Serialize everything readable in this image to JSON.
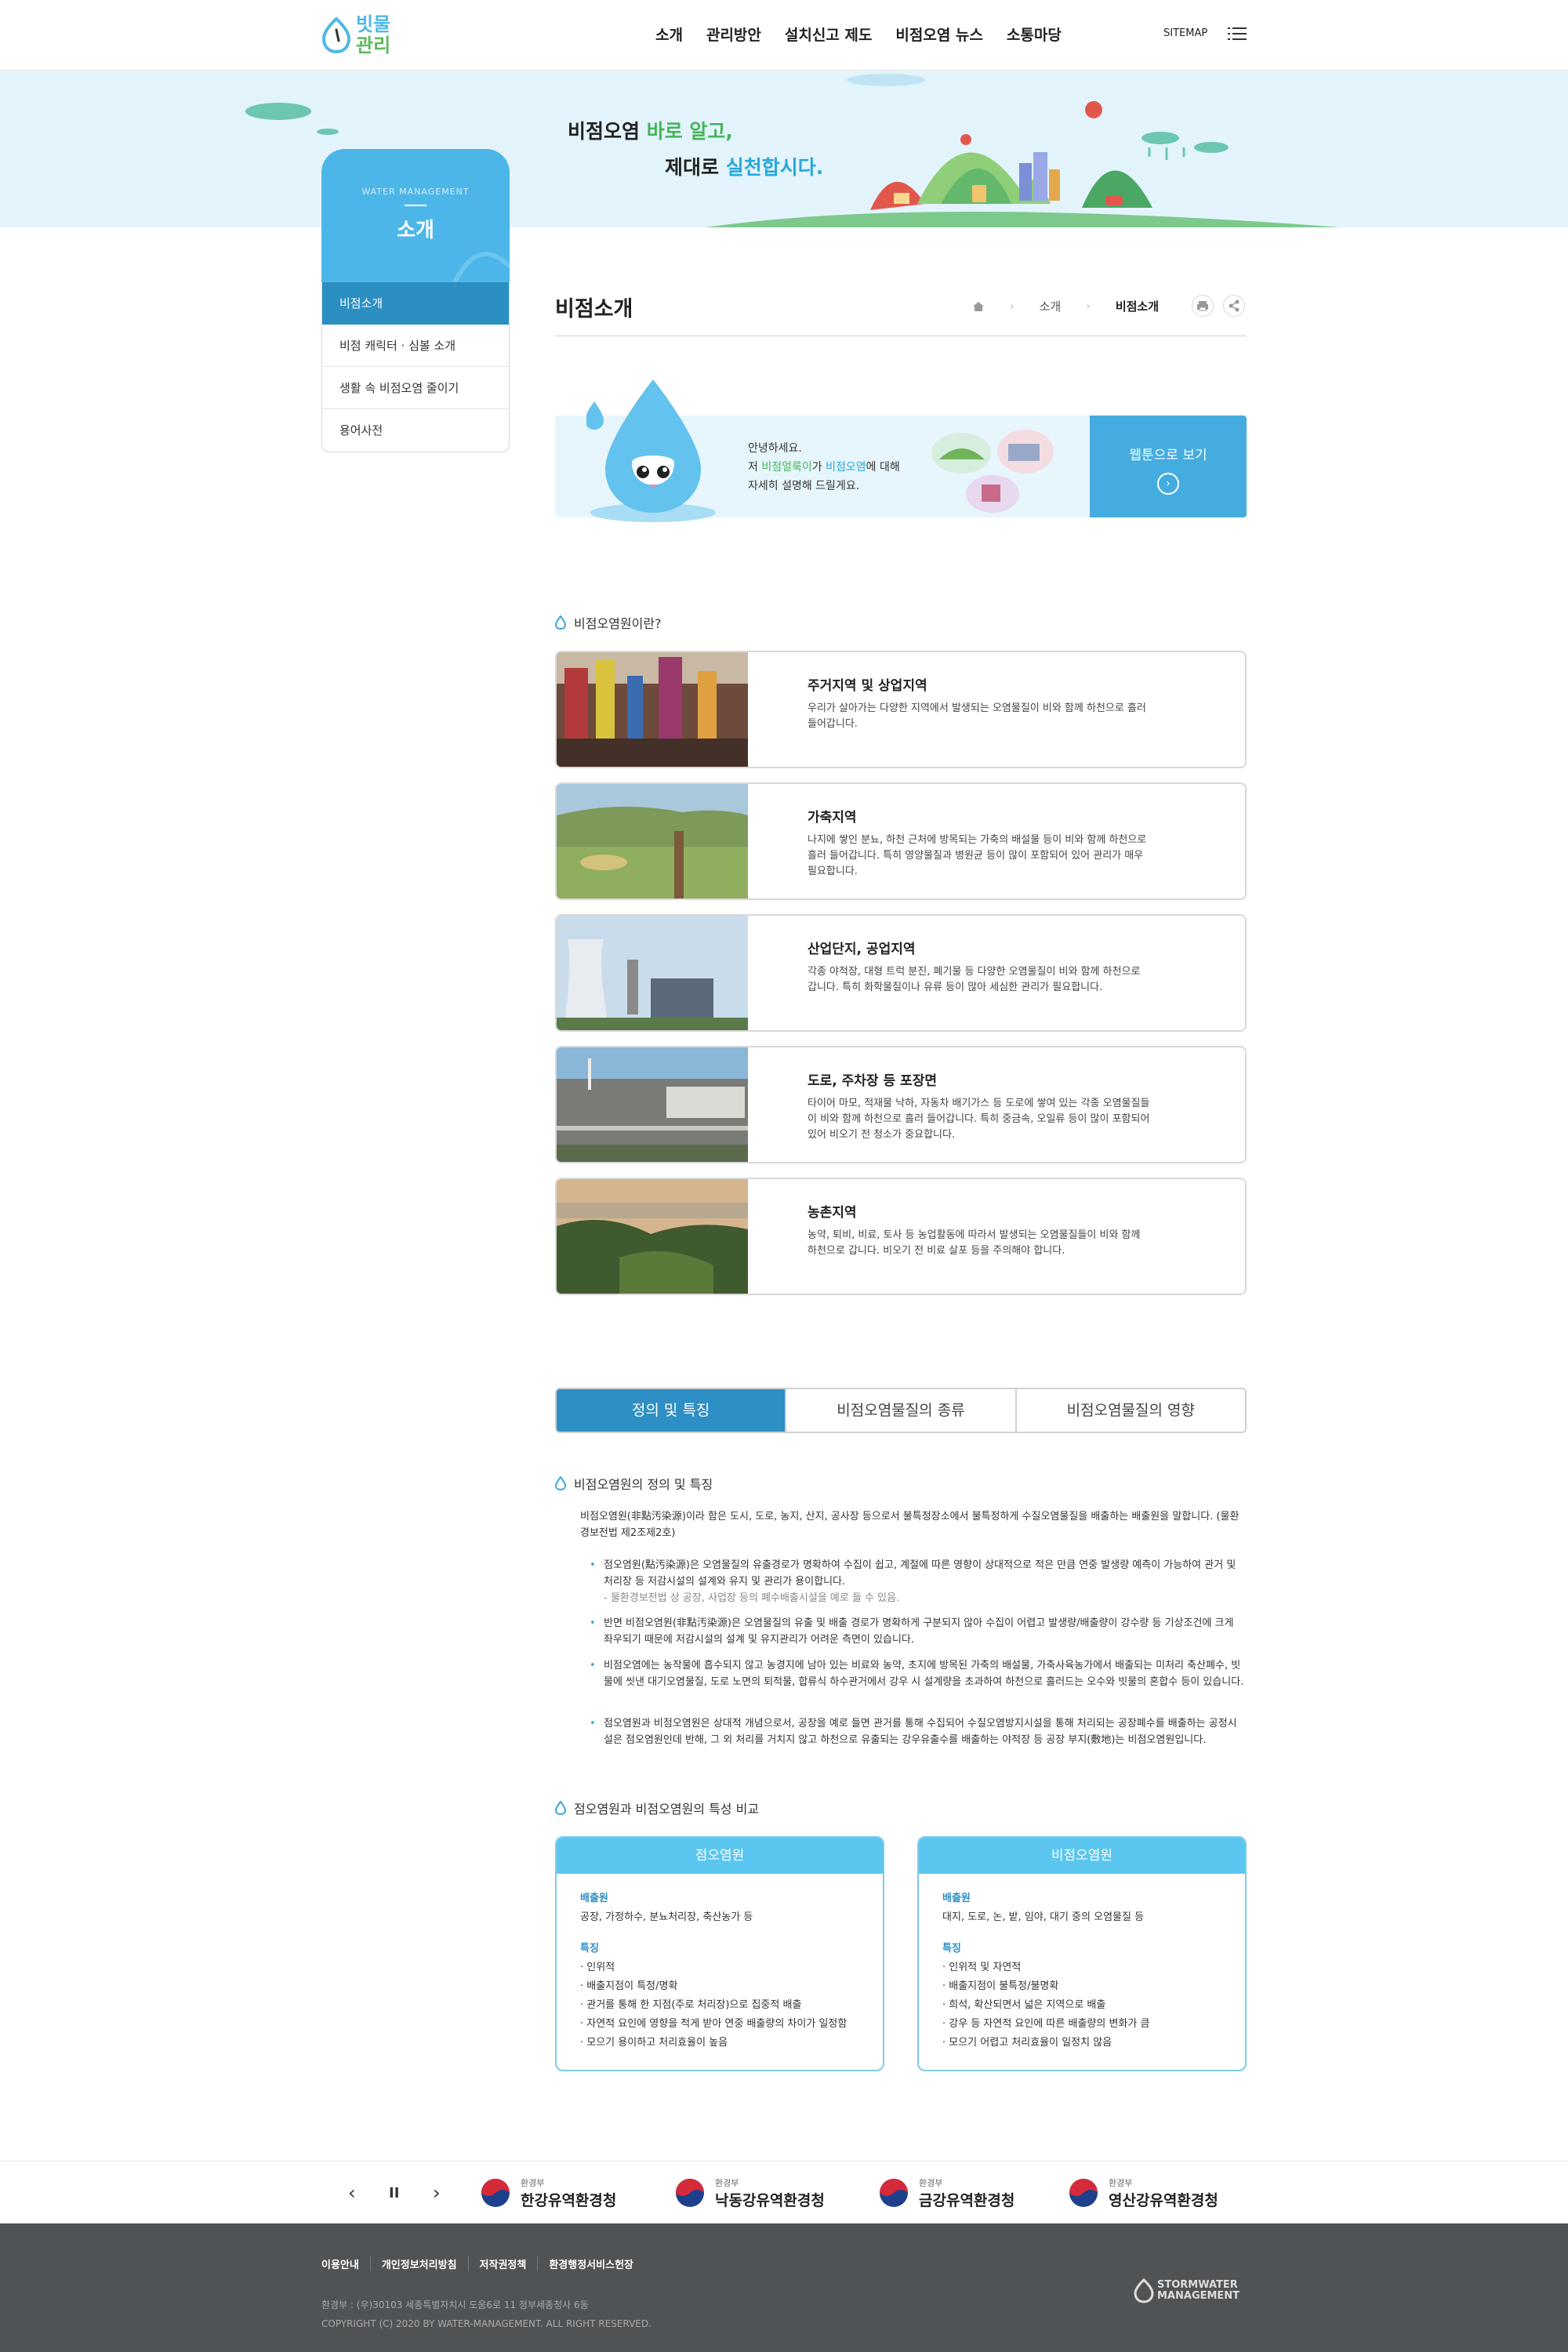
{
  "header": {
    "logo_line1": "빗물",
    "logo_line2": "관리",
    "gnb": [
      "소개",
      "관리방안",
      "설치신고 제도",
      "비점오염 뉴스",
      "소통마당"
    ],
    "sitemap": "SITEMAP"
  },
  "hero": {
    "line1_a": "비점오염 ",
    "line1_b": "바로 알고,",
    "line2_a": "제대로 ",
    "line2_b": "실천합시다."
  },
  "lnb": {
    "sub": "WATER MANAGEMENT",
    "title": "소개",
    "items": [
      "비점소개",
      "비점 캐릭터 · 심볼 소개",
      "생활 속 비점오염 줄이기",
      "용어사전"
    ]
  },
  "page": {
    "title": "비점소개",
    "breadcrumb": [
      "소개",
      "비점소개"
    ]
  },
  "banner": {
    "line1": "안녕하세요.",
    "line2_a": "저 ",
    "line2_b": "비점얼룩이",
    "line2_c": "가 ",
    "line2_d": "비점오염",
    "line2_e": "에 대해",
    "line3": "자세히 설명해 드릴게요.",
    "button": "웹툰으로 보기"
  },
  "sources": {
    "title": "비점오염원이란?",
    "cards": [
      {
        "title": "주거지역 및 상업지역",
        "desc": "우리가 살아가는 다양한 지역에서 발생되는 오염물질이 비와 함께 하천으로 흘러 들어갑니다."
      },
      {
        "title": "가축지역",
        "desc": "나지에 쌓인 분뇨, 하천 근처에 방목되는 가축의 배설물 등이 비와 함께 하천으로 흘러 들어갑니다. 특히 영양물질과 병원균 등이 많이 포함되어 있어 관리가 매우 필요합니다."
      },
      {
        "title": "산업단지, 공업지역",
        "desc": "각종 야적장, 대형 트럭 분진, 폐기물 등 다양한 오염물질이 비와 함께 하천으로 갑니다. 특히 화학물질이나 유류 등이 많아 세심한 관리가 필요합니다."
      },
      {
        "title": "도로, 주차장 등 포장면",
        "desc": "타이어 마모, 적재물 낙하, 자동차 배기가스 등 도로에 쌓여 있는 각종 오염물질들이 비와 함께 하천으로 흘러 들어갑니다. 특히 중금속, 오일류 등이 많이 포함되어 있어 비오기 전 청소가 중요합니다."
      },
      {
        "title": "농촌지역",
        "desc": "농약, 퇴비, 비료, 토사 등 농업활동에 따라서 발생되는 오염물질들이 비와 함께 하천으로 갑니다. 비오기 전 비료 살포 등을 주의해야 합니다."
      }
    ]
  },
  "tabs": [
    "정의 및 특징",
    "비점오염물질의 종류",
    "비점오염물질의 영향"
  ],
  "definition": {
    "title": "비점오염원의 정의 및 특징",
    "intro": "비점오염원(非點汚染源)이라 함은 도시, 도로, 농지, 산지, 공사장 등으로서 불특정장소에서 불특정하게 수질오염물질을 배출하는 배출원을 말합니다. (물환경보전법 제2조제2호)",
    "bullets": [
      {
        "text": "점오염원(點汚染源)은 오염물질의 유출경로가 명확하여 수집이 쉽고, 계절에 따른 영향이 상대적으로 적은 만큼 연중 발생량 예측이 가능하여 관거 및 처리장 등 저감시설의 설계와 유지 및 관리가 용이합니다.",
        "sub": "- 물환경보전법 상 공장, 사업장 등의 폐수배출시설을 예로 들 수 있음."
      },
      {
        "text": "반면 비점오염원(非點汚染源)은 오염물질의 유출 및 배출 경로가 명확하게 구분되지 않아 수집이 어렵고 발생량/배출량이 강수량 등 기상조건에 크게 좌우되기 때문에 저감시설의 설계 및 유지관리가 어려운 측면이 있습니다.",
        "sub": ""
      },
      {
        "text": "비점오염에는 농작물에 흡수되지 않고 농경지에 남아 있는 비료와 농약, 초지에 방목된 가축의 배설물, 가축사육농가에서 배출되는 미처리 축산폐수, 빗물에 씻낸 대기오염물질, 도로 노면의 퇴적물, 합류식 하수관거에서 강우 시 설계량을 초과하여 하천으로 흘러드는 오수와 빗물의 혼합수 등이 있습니다.",
        "sub": ""
      },
      {
        "text": "점오염원과 비점오염원은 상대적 개념으로서, 공장을 예로 들면 관거를 통해 수집되어 수질오염방지시설을 통해 처리되는 공장폐수를 배출하는 공정시설은 점오염원인데 반해, 그 외 처리를 거치지 않고 하천으로 유출되는 강우유출수를 배출하는 야적장 등 공장 부지(敷地)는 비점오염원입니다.",
        "sub": ""
      }
    ]
  },
  "compare": {
    "title": "점오염원과 비점오염원의 특성 비교",
    "point": {
      "head": "점오염원",
      "source_label": "배출원",
      "source": "공장, 가정하수, 분뇨처리장, 축산농가 등",
      "feature_label": "특징",
      "features": [
        "· 인위적",
        "· 배출지점이 특정/명확",
        "· 관거를 통해 한 지점(주로 처리장)으로 집중적 배출",
        "· 자연적 요인에 영향을 적게 받아 연중 배출량의 차이가 일정함",
        "· 모으기 용이하고 처리효율이 높음"
      ]
    },
    "nonpoint": {
      "head": "비점오염원",
      "source_label": "배출원",
      "source": "대지, 도로, 논, 밭, 임야, 대기 중의 오염물질 등",
      "feature_label": "특징",
      "features": [
        "· 인위적 및 자연적",
        "· 배출지점이 불특정/불명확",
        "· 희석, 확산되면서 넓은 지역으로 배출",
        "· 강우 등 자연적 요인에 따른 배출량의 변화가 큼",
        "· 모으기 어렵고 처리효율이 일정치 않음"
      ]
    }
  },
  "related": {
    "orgs": [
      {
        "sub": "환경부",
        "name": "한강유역환경청"
      },
      {
        "sub": "환경부",
        "name": "낙동강유역환경청"
      },
      {
        "sub": "환경부",
        "name": "금강유역환경청"
      },
      {
        "sub": "환경부",
        "name": "영산강유역환경청"
      }
    ]
  },
  "footer": {
    "links": [
      "이용안내",
      "개인정보처리방침",
      "저작권정책",
      "환경행정서비스헌장"
    ],
    "address": "환경부 : (우)30103 세종특별자치시 도움6로 11 정부세종청사 6동",
    "copyright": "COPYRIGHT (C) 2020 BY WATER-MANAGEMENT. ALL RIGHT RESERVED.",
    "logo_line1": "STORMWATER",
    "logo_line2": "MANAGEMENT"
  },
  "colors": {
    "primary": "#2d8fc4",
    "light": "#4db6e8",
    "green": "#45b55a",
    "footer": "#505356"
  }
}
